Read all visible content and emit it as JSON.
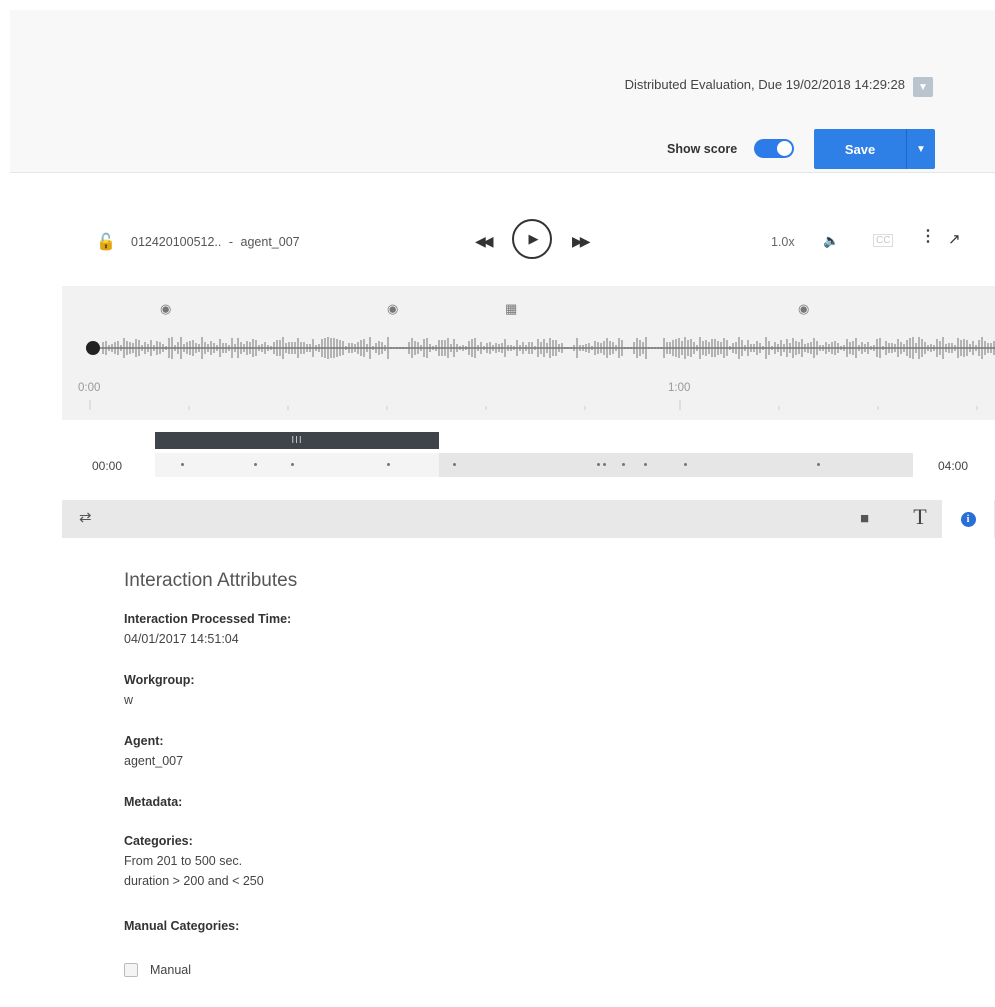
{
  "header": {
    "evaluation_title": "Distributed Evaluation, Due 19/02/2018 14:29:28",
    "show_score_label": "Show score",
    "show_score_on": true,
    "save_label": "Save"
  },
  "player": {
    "interaction_id": "012420100512..",
    "separator": "-",
    "agent": "agent_007",
    "speed": "1.0x"
  },
  "waveform": {
    "time_labels": [
      "0:00",
      "1:00"
    ]
  },
  "timeline": {
    "start": "00:00",
    "end": "04:00",
    "handle": "III"
  },
  "attributes": {
    "title": "Interaction Attributes",
    "processed_time_label": "Interaction Processed Time:",
    "processed_time": "04/01/2017 14:51:04",
    "workgroup_label": "Workgroup:",
    "workgroup": "w",
    "agent_label": "Agent:",
    "agent": "agent_007",
    "metadata_label": "Metadata:",
    "categories_label": "Categories:",
    "categories": [
      "From 201 to 500 sec.",
      "duration > 200 and < 250"
    ],
    "manual_categories_label": "Manual Categories:",
    "manual_option": "Manual"
  },
  "colors": {
    "accent": "#2e7fe6",
    "toggle": "#2d7be8",
    "info_icon": "#2a6fd6"
  },
  "icons": [
    "lock-open-icon",
    "rewind-icon",
    "play-icon",
    "fast-forward-icon",
    "volume-icon",
    "captions-icon",
    "more-vert-icon",
    "popout-icon",
    "marker-pin-icon",
    "note-marker-icon",
    "list-toggle-icon",
    "comment-icon",
    "text-icon",
    "info-icon"
  ]
}
